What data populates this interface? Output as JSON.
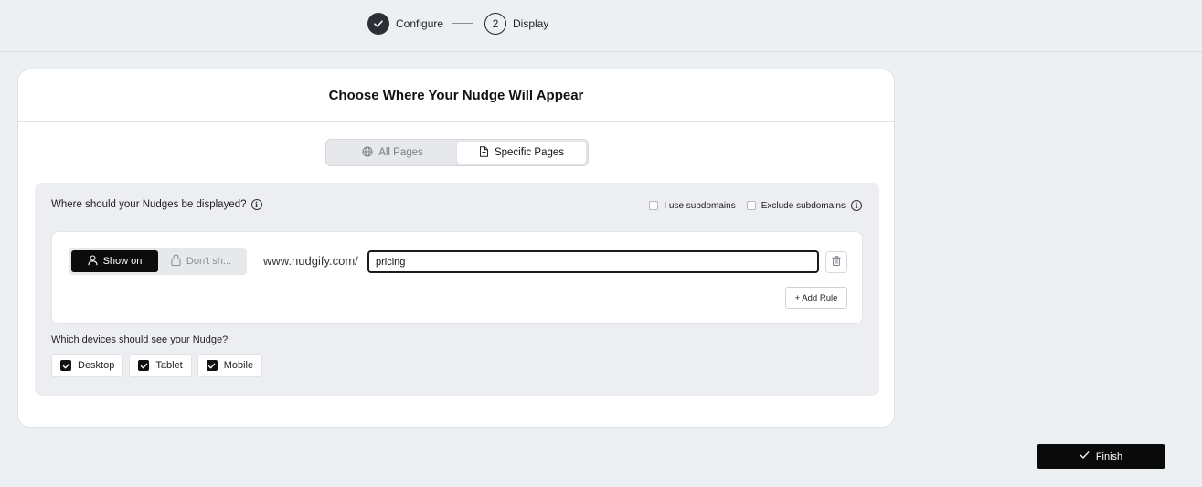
{
  "stepper": {
    "steps": [
      {
        "label": "Configure",
        "state": "done"
      },
      {
        "label": "Display",
        "number": "2",
        "state": "current"
      }
    ]
  },
  "card": {
    "title": "Choose Where Your Nudge Will Appear",
    "tabs": [
      {
        "label": "All Pages",
        "icon": "globe-icon",
        "active": false
      },
      {
        "label": "Specific Pages",
        "icon": "file-icon",
        "active": true
      }
    ]
  },
  "panel": {
    "question_display": "Where should your Nudges be displayed?",
    "subdomain_options": [
      {
        "label": "I use subdomains",
        "checked": false
      },
      {
        "label": "Exclude subdomains",
        "checked": false
      }
    ],
    "rule": {
      "show_on_label": "Show on",
      "dont_show_label": "Don't sh...",
      "domain": "www.nudgify.com/",
      "path_value": "pricing"
    },
    "add_rule_label": "+ Add Rule",
    "question_devices": "Which devices should see your Nudge?",
    "devices": [
      {
        "label": "Desktop",
        "checked": true
      },
      {
        "label": "Tablet",
        "checked": true
      },
      {
        "label": "Mobile",
        "checked": true
      }
    ]
  },
  "footer": {
    "finish_label": "Finish"
  },
  "colors": {
    "background": "#edf0f3",
    "primary": "#0a0a0a",
    "panel": "#eceef1"
  }
}
